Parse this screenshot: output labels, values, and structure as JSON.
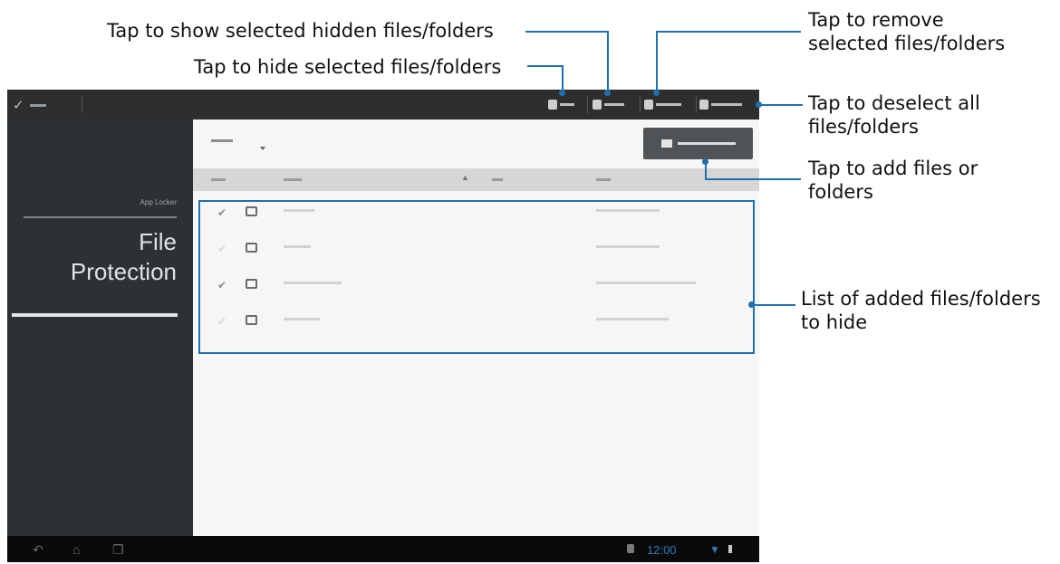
{
  "callouts": {
    "show_hidden": "Tap to show selected hidden files/folders",
    "hide_selected": "Tap to hide selected files/folders",
    "remove_line1": "Tap to remove",
    "remove_line2": "selected files/folders",
    "deselect_line1": "Tap to deselect all",
    "deselect_line2": "files/folders",
    "add_line1": "Tap to add files or",
    "add_line2": "folders",
    "list_line1": "List of added files/folders",
    "list_line2": "to hide"
  },
  "sidebar": {
    "app_name": "App Locker",
    "title_line1": "File",
    "title_line2": "Protection"
  },
  "statusbar": {
    "clock": "12:00"
  },
  "colors": {
    "callout_line": "#1f6fb0",
    "action_bar": "#2e2e2e",
    "sidebar": "#2d3135",
    "clock": "#2b7bb8"
  },
  "icons": {
    "done": "check-icon",
    "hide": "hide-icon",
    "unhide": "unhide-icon",
    "remove": "trash-icon",
    "deselect": "deselect-icon",
    "add": "folder-add-icon",
    "row_item": "folder-icon",
    "nav": [
      "back-icon",
      "home-icon",
      "recent-apps-icon"
    ]
  }
}
